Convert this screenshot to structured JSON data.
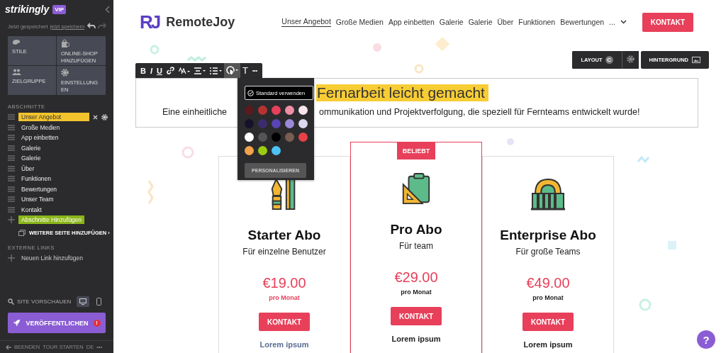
{
  "sidebar": {
    "brand": "strikingly",
    "badge": "VIP",
    "saved_text": "Jetzt gespeichert",
    "save_link": "jetzt speichern",
    "tiles": [
      {
        "kind": "styles",
        "label": "STILE"
      },
      {
        "kind": "shop",
        "label": "ONLINE-SHOP HINZUFÜGEN"
      },
      {
        "kind": "audience",
        "label": "ZIELGRUPPE"
      },
      {
        "kind": "settings",
        "label": "EINSTELLUNGEN"
      }
    ],
    "sections_heading": "ABSCHNITTE",
    "sections": [
      {
        "label": "Unser Angebot",
        "selected": true
      },
      {
        "label": "Große Medien",
        "selected": false
      },
      {
        "label": "App einbetten",
        "selected": false
      },
      {
        "label": "Galerie",
        "selected": false
      },
      {
        "label": "Galerie",
        "selected": false
      },
      {
        "label": "Über",
        "selected": false
      },
      {
        "label": "Funktionen",
        "selected": false
      },
      {
        "label": "Bewertungen",
        "selected": false
      },
      {
        "label": "Unser Team",
        "selected": false
      },
      {
        "label": "Kontakt",
        "selected": false
      }
    ],
    "add_section": "Abschnitte Hinzufügen",
    "add_page": "WEITERE SEITE HINZUFÜGEN ›",
    "external_heading": "EXTERNE LINKS",
    "add_link": "Neuen Link hinzufügen",
    "preview": "SITE VORSCHAUEN",
    "devices": [
      {
        "kind": "desktop",
        "selected": true
      },
      {
        "kind": "mobile",
        "selected": false
      }
    ],
    "publish": "VERÖFFENTLICHEN",
    "publish_alert": "!",
    "footer": [
      "BEENDEN",
      "TOUR STARTEN",
      "DE",
      "•••"
    ]
  },
  "site": {
    "logo_mark": "RJ",
    "logo_text": "RemoteJoy",
    "nav": [
      {
        "label": "Unser Angebot",
        "selected": true
      },
      {
        "label": "Große Medien",
        "selected": false
      },
      {
        "label": "App einbetten",
        "selected": false
      },
      {
        "label": "Galerie",
        "selected": false
      },
      {
        "label": "Galerie",
        "selected": false
      },
      {
        "label": "Über",
        "selected": false
      },
      {
        "label": "Funktionen",
        "selected": false
      },
      {
        "label": "Bewertungen",
        "selected": false
      }
    ],
    "nav_more": "...",
    "cta": "KONTAKT"
  },
  "section_tools": {
    "layout": "LAYOUT",
    "layout_badge": "C",
    "background": "HINTERGRUND"
  },
  "toolbar": [
    {
      "kind": "bold",
      "label": "B",
      "selected": false
    },
    {
      "kind": "italic",
      "label": "I",
      "selected": false
    },
    {
      "kind": "underline",
      "label": "U",
      "selected": false
    },
    {
      "kind": "link",
      "selected": false
    },
    {
      "kind": "font-size",
      "selected": false
    },
    {
      "kind": "align",
      "selected": false
    },
    {
      "kind": "list",
      "selected": false
    },
    {
      "kind": "color",
      "selected": true
    },
    {
      "kind": "text-style",
      "label": "T",
      "selected": false
    },
    {
      "kind": "more",
      "label": "•••",
      "selected": false
    }
  ],
  "heading": {
    "title": "Fernarbeit leicht gemacht",
    "subtitle_start": "Eine einheitliche",
    "subtitle_end": "ommunikation und Projektverfolgung, die speziell für Fernteams entwickelt wurde!"
  },
  "color_popup": {
    "default_button": "Standard verwenden",
    "swatches": [
      {
        "color": "#5a1a1f"
      },
      {
        "color": "#b83232"
      },
      {
        "color": "#e8405a"
      },
      {
        "color": "#ee8fa6"
      },
      {
        "color": "#f9e4ea"
      },
      {
        "color": "#16122a"
      },
      {
        "color": "#3a2c6e"
      },
      {
        "color": "#5a44b8"
      },
      {
        "color": "#9a8ad6"
      },
      {
        "color": "#dcd7f0"
      },
      {
        "color": "#ffffff"
      },
      {
        "color": "#555555"
      },
      {
        "color": "#000000"
      },
      {
        "color": "#7a5c50"
      },
      {
        "color": "#e84048"
      },
      {
        "color": "#f2a24a"
      },
      {
        "color": "#9acd12"
      },
      {
        "color": "#4cc3f5"
      }
    ],
    "custom_button": "PERSONALISIEREN"
  },
  "plans": [
    {
      "kind": "pen",
      "title": "Starter Abo",
      "subtitle": "Für einzelne Benutzer",
      "price": "€19.00",
      "period": "pro Monat",
      "button": "KONTAKT",
      "feature": "Lorem ipsum",
      "featured": false,
      "highlighted": true
    },
    {
      "kind": "clipboard",
      "badge": "BELIEBT",
      "title": "Pro Abo",
      "subtitle": "Für team",
      "price": "€29.00",
      "period": "pro Monat",
      "button": "KONTAKT",
      "feature": "Lorem ipsum",
      "featured": true,
      "highlighted": false
    },
    {
      "kind": "building",
      "title": "Enterprise Abo",
      "subtitle": "Für große Teams",
      "price": "€49.00",
      "period": "pro Monat",
      "button": "KONTAKT",
      "feature": "Lorem ipsum",
      "featured": false,
      "highlighted": false
    }
  ],
  "help": "?"
}
